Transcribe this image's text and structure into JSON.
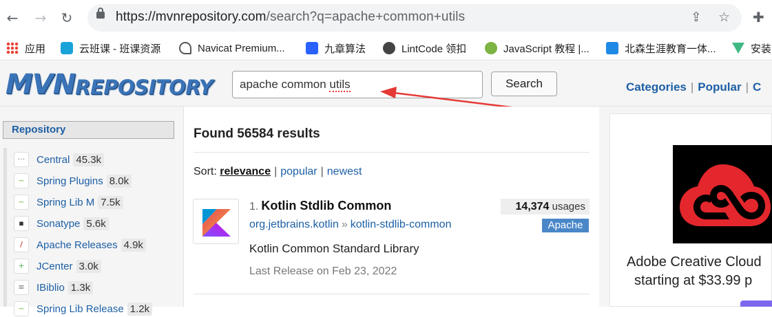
{
  "browser": {
    "url_host": "https://mvnrepository.com",
    "url_path": "/search?q=apache+common+utils",
    "icons": [
      "back-icon",
      "forward-icon",
      "reload-icon",
      "lock-icon",
      "share-icon",
      "star-icon",
      "extension-icon"
    ]
  },
  "bookmarks": [
    {
      "label": "应用",
      "icon": "apps-grid-icon",
      "color": "#e8453c"
    },
    {
      "label": "云班课 - 班课资源",
      "icon": "cloud-icon",
      "color": "#1aa3d9"
    },
    {
      "label": "Navicat Premium...",
      "icon": "navicat-icon",
      "color": "#555555"
    },
    {
      "label": "九章算法",
      "icon": "jiuzhang-icon",
      "color": "#2962ff"
    },
    {
      "label": "LintCode 领扣",
      "icon": "lintcode-icon",
      "color": "#444444"
    },
    {
      "label": "JavaScript 教程 |...",
      "icon": "js-icon",
      "color": "#4caf50"
    },
    {
      "label": "北森生涯教育一体...",
      "icon": "beisen-icon",
      "color": "#1e88e5"
    },
    {
      "label": "安装",
      "icon": "vue-icon",
      "color": "#41b883"
    }
  ],
  "header": {
    "logo_big": "MVN",
    "logo_small": "REPOSITORY",
    "search_prefix": "apache common ",
    "search_typed": "utils",
    "search_button": "Search",
    "links": [
      "Categories",
      "Popular",
      "C"
    ]
  },
  "sidebar": {
    "heading": "Repository",
    "items": [
      {
        "name": "Central",
        "count": "45.3k",
        "glyph": "···"
      },
      {
        "name": "Spring Plugins",
        "count": "8.0k",
        "glyph": "~"
      },
      {
        "name": "Spring Lib M",
        "count": "7.5k",
        "glyph": "~"
      },
      {
        "name": "Sonatype",
        "count": "5.6k",
        "glyph": "▪"
      },
      {
        "name": "Apache Releases",
        "count": "4.9k",
        "glyph": "/"
      },
      {
        "name": "JCenter",
        "count": "3.0k",
        "glyph": "+"
      },
      {
        "name": "IBiblio",
        "count": "1.3k",
        "glyph": "≡"
      },
      {
        "name": "Spring Lib Release",
        "count": "1.2k",
        "glyph": "~"
      }
    ]
  },
  "main": {
    "found_text": "Found 56584 results",
    "sort_label": "Sort:",
    "sort_options": [
      "relevance",
      "popular",
      "newest"
    ],
    "result": {
      "index": "1.",
      "title": "Kotlin Stdlib Common",
      "group": "org.jetbrains.kotlin",
      "artifact": "kotlin-stdlib-common",
      "usages_count": "14,374",
      "usages_label": "usages",
      "license": "Apache",
      "description": "Kotlin Common Standard Library",
      "release": "Last Release on Feb 23, 2022"
    }
  },
  "ad": {
    "line1": "Adobe Creative Cloud",
    "line2": "starting at $33.99 p"
  },
  "colors": {
    "link": "#1d5fa4",
    "license_badge": "#4a87c8",
    "annotation_arrow": "#e53935"
  }
}
